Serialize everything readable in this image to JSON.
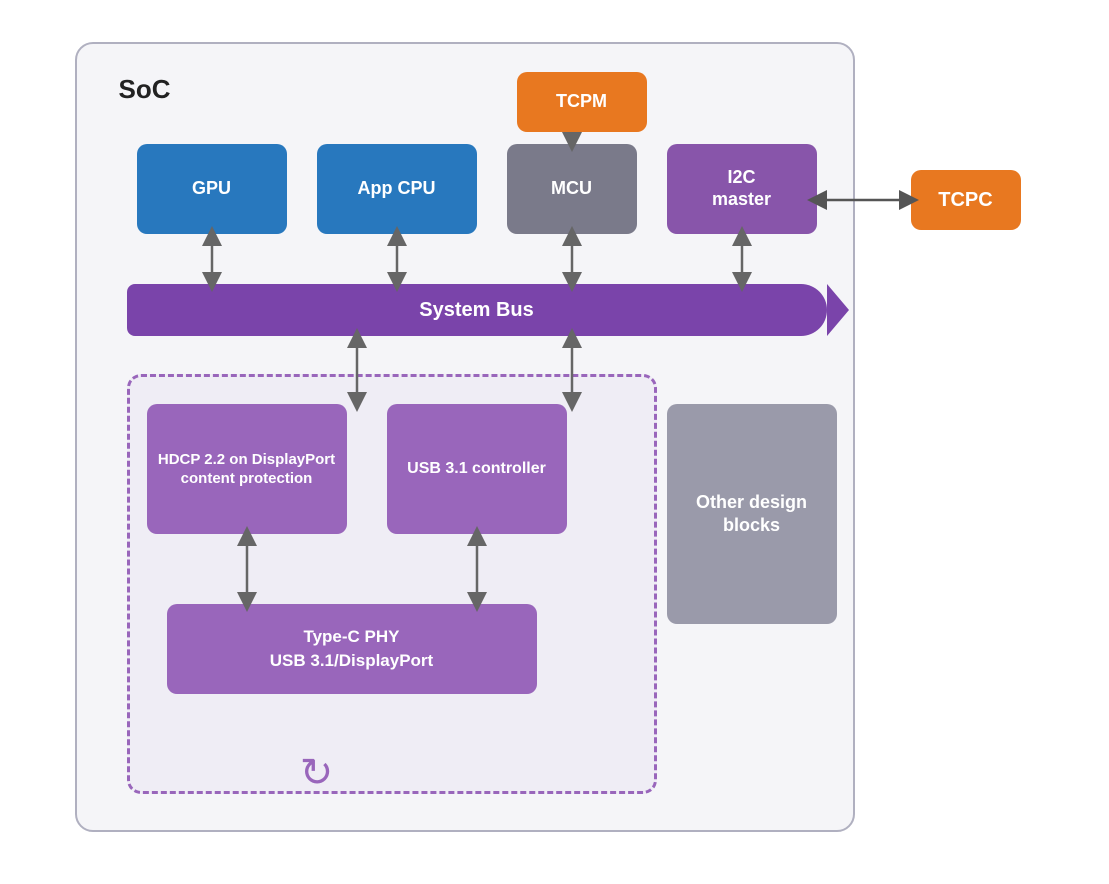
{
  "diagram": {
    "title": "SoC",
    "blocks": {
      "gpu": {
        "label": "GPU"
      },
      "appcpu": {
        "label": "App CPU"
      },
      "tcpm": {
        "label": "TCPM"
      },
      "mcu": {
        "label": "MCU"
      },
      "i2cmaster": {
        "label": "I2C\nmaster"
      },
      "tcpc": {
        "label": "TCPC"
      },
      "system_bus": {
        "label": "System Bus"
      },
      "hdcp": {
        "label": "HDCP 2.2 on DisplayPort content protection"
      },
      "usb": {
        "label": "USB 3.1 controller"
      },
      "typephy": {
        "label": "Type-C PHY\nUSB 3.1/DisplayPort"
      },
      "other": {
        "label": "Other design blocks"
      }
    },
    "colors": {
      "blue": "#2878be",
      "gray": "#7a7a8a",
      "purple_dark": "#7a44aa",
      "purple_mid": "#8855aa",
      "purple_light": "#9966bb",
      "orange": "#e87820",
      "other_gray": "#9a9aaa"
    }
  }
}
